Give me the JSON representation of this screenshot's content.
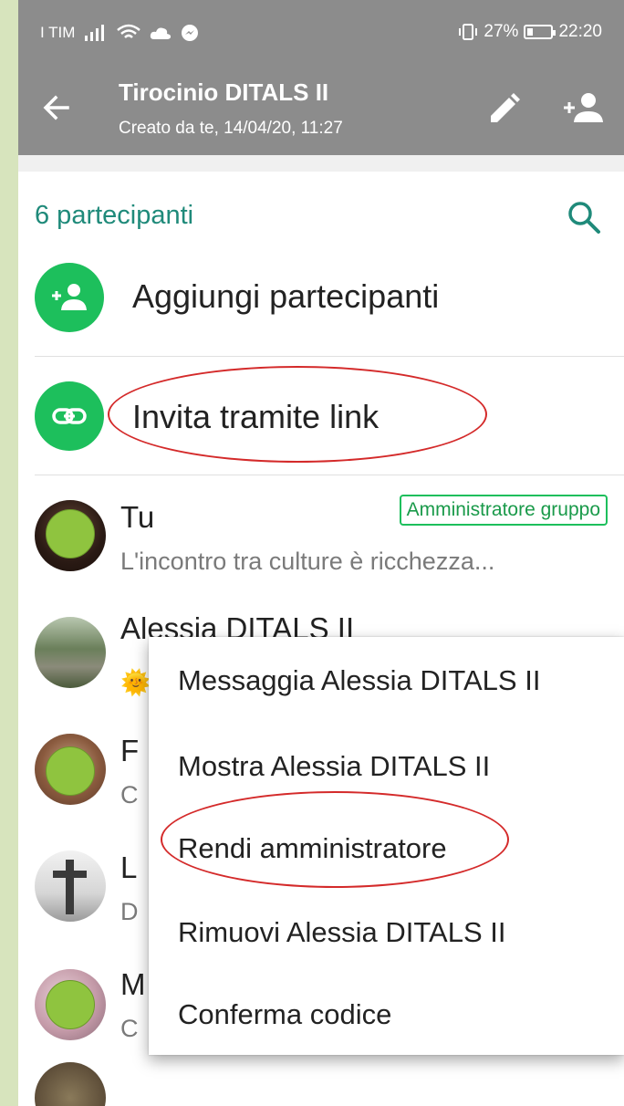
{
  "status_bar": {
    "carrier": "I TIM",
    "battery": "27%",
    "battery_level": 0.27,
    "time": "22:20"
  },
  "app_bar": {
    "title": "Tirocinio DITALS II",
    "subtitle": "Creato da te, 14/04/20, 11:27"
  },
  "participants": {
    "header": "6 partecipanti",
    "add_label": "Aggiungi partecipanti",
    "invite_label": "Invita tramite link"
  },
  "members": [
    {
      "name": "Tu",
      "status": "L'incontro tra culture è ricchezza...",
      "badge": "Amministratore gruppo"
    },
    {
      "name": "Alessia DITALS II",
      "status": "🌞"
    },
    {
      "name": "F",
      "status": "C"
    },
    {
      "name": "L",
      "status": "D"
    },
    {
      "name": "M",
      "status": "C"
    }
  ],
  "context_menu": {
    "items": [
      "Messaggia Alessia DITALS II",
      "Mostra Alessia DITALS II",
      "Rendi amministratore",
      "Rimuovi Alessia DITALS II",
      "Conferma codice"
    ]
  },
  "colors": {
    "page_background": "#d7e4bd",
    "app_bar": "#8c8c8c",
    "accent_green": "#1dbf5c",
    "section_title": "#1f8a7a",
    "annotation_red": "#d42a2a"
  }
}
